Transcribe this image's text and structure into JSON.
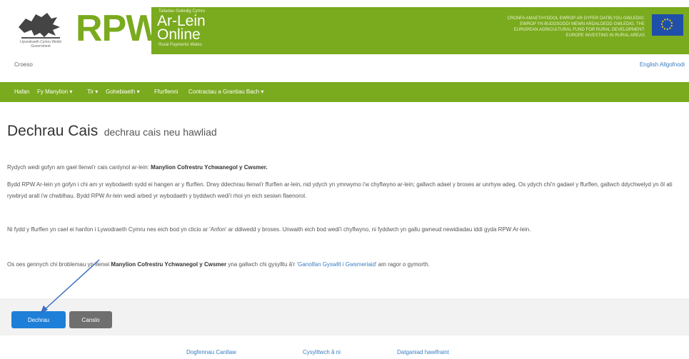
{
  "header": {
    "brand": "RPW",
    "service_title_line1": "Ar-Lein",
    "service_title_line2": "Online",
    "tagline_top": "Taliadau Gwledig Cymru",
    "tagline_bottom": "Rural Payments Wales",
    "eu_text": "CRONFA AMAETHYDDOL EWROP AR GYFER DATBLYGU GWLEDIG: EWROP YN BUDDSODDI MEWN ARDALOEDD GWLEDIG. THE EUROPEAN AGRICULTURAL FUND FOR RURAL DEVELOPMENT: EUROPE INVESTING IN RURAL AREAS",
    "logo_caption": "Llywodraeth Cymru Welsh Government"
  },
  "utility": {
    "left": "Croeso",
    "lang_english": "English",
    "logout": "Allgofnodi"
  },
  "nav": {
    "items": [
      {
        "label": "Hafan"
      },
      {
        "label": "Fy Manylion ▾"
      },
      {
        "label": "Tir ▾"
      },
      {
        "label": "Gohebiaeth ▾"
      },
      {
        "label": "Ffurflenni"
      },
      {
        "label": "Contractau a Grantiau Bach ▾"
      }
    ]
  },
  "main": {
    "title": "Dechrau Cais",
    "subtitle": "dechrau cais neu hawliad",
    "p1_text": "Rydych wedi gofyn am gael llenwi'r cais canlynol ar-lein: ",
    "p1_bold": "Manylion Cofrestru Ychwanegol y Cwsmer.",
    "p2": "Bydd RPW Ar-lein yn gofyn i chi am yr wybodaeth sydd ei hangen ar y ffurflen. Drwy ddechrau llenwi'r ffurflen ar-lein, nid ydych yn ymrwymo i'w chyflwyno ar-lein; gallwch adael y broses ar unrhyw adeg. Os ydych chi'n gadael y ffurflen, gallwch ddychwelyd yn ôl ati rywbryd arall i'w chwblhau. Bydd RPW Ar-lein wedi arbed yr wybodaeth y byddwch wedi'i rhoi yn eich sesiwn flaenorol.",
    "p3": "Ni fydd y ffurflen yn cael ei hanfon i Lywodraeth Cymru nes eich bod yn clicio ar 'Anfon' ar ddiwedd y broses. Unwaith eich bod wedi'i chyflwyno, ni fyddwch yn gallu gwneud newidiadau iddi gyda RPW Ar-lein.",
    "p4_a": "Os oes gennych chi broblemau yn llenwi ",
    "p4_bold": "Manylion Cofrestru Ychwanegol y Cwsmer",
    "p4_b": " yna gallwch chi gysylltu â'r ",
    "p4_link": "'Ganolfan Gyswllt i Gwsmeriaid'",
    "p4_c": " am ragor o gymorth."
  },
  "actions": {
    "start": "Dechrau",
    "cancel": "Canslo"
  },
  "footer": {
    "links": [
      "Dogfennau Canllaw",
      "Cysylltwch â ni",
      "Datganiad hawlfraint"
    ]
  },
  "colors": {
    "brand_green": "#7aaa1e",
    "primary_blue": "#1e7fd8",
    "secondary_gray": "#6f6f6f",
    "link_blue": "#3a7cc1",
    "annotation_arrow": "#3b6fc4"
  }
}
